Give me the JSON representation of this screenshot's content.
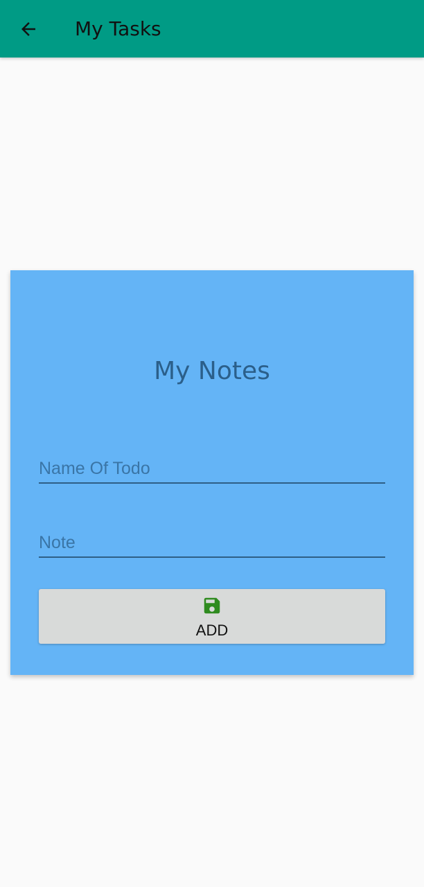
{
  "app_bar": {
    "back_icon": "arrow-left-icon",
    "title": "My Tasks",
    "background_color": "#009b85"
  },
  "card": {
    "title": "My Notes",
    "background_color": "#64b4f6",
    "name_field": {
      "placeholder": "Name Of Todo",
      "value": ""
    },
    "note_field": {
      "placeholder": "Note",
      "value": ""
    },
    "add_button": {
      "label": "ADD",
      "icon": "save-icon",
      "icon_color": "#2e8b1f"
    }
  }
}
